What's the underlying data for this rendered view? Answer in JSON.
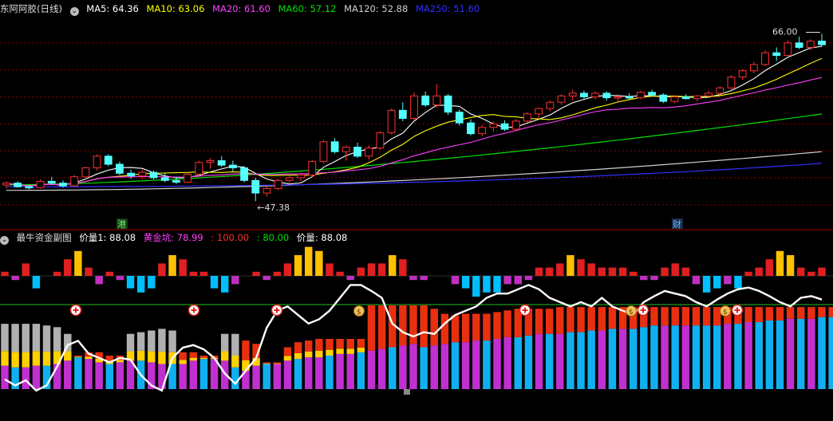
{
  "top_header": {
    "stock_name": "东阿阿胶(日线)",
    "ma5_label": "MA5: 64.36",
    "ma10_label": "MA10: 63.06",
    "ma20_label": "MA20: 61.60",
    "ma60_label": "MA60: 57.12",
    "ma120_label": "MA120: 52.88",
    "ma250_label": "MA250: 51.60"
  },
  "bottom_header": {
    "indicator_name": "最牛资金副图",
    "price1_label": "价量1: 88.08",
    "gold_pit_label": "黄金坑: 78.99",
    "v100_label": ": 100.00",
    "v80_label": ": 80.00",
    "price_label": "价量: 88.08"
  },
  "annotations": {
    "high_price": "66.00",
    "low_price": "47.38",
    "marker_gang": "港",
    "marker_cai": "财"
  },
  "colors": {
    "background": "#000000",
    "up_candle": "#ff3030",
    "down_candle": "#54ffff",
    "ma5": "#ffffff",
    "ma10": "#ffff00",
    "ma20": "#ff40ff",
    "ma60": "#00e000",
    "ma120": "#d0d0d0",
    "ma250": "#3030ff",
    "grid": "#800000",
    "hist_up": "#e02020",
    "hist_up_hi": "#ffc000",
    "hist_down": "#00bfff",
    "hist_down_hi": "#c030c0",
    "bar_red": "#e83010",
    "bar_yellow": "#ffd000",
    "bar_blue": "#10b0f0",
    "bar_magenta": "#c030d0",
    "bar_gray": "#b0b0b0",
    "line80": "#20c020"
  },
  "chart_data": [
    {
      "type": "candlestick",
      "title": "东阿阿胶(日线)",
      "series": [
        {
          "name": "MA5"
        },
        {
          "name": "MA10"
        },
        {
          "name": "MA20"
        },
        {
          "name": "MA60"
        },
        {
          "name": "MA120"
        },
        {
          "name": "MA250"
        }
      ],
      "ylim": [
        46,
        68
      ],
      "candles": [
        [
          49.2,
          49.6,
          48.8,
          49.4
        ],
        [
          49.4,
          49.6,
          48.9,
          49.0
        ],
        [
          49.0,
          49.2,
          48.7,
          48.9
        ],
        [
          48.9,
          49.8,
          48.8,
          49.6
        ],
        [
          49.6,
          50.1,
          49.2,
          49.4
        ],
        [
          49.4,
          49.7,
          48.9,
          49.1
        ],
        [
          49.1,
          50.3,
          49.0,
          50.1
        ],
        [
          50.1,
          51.2,
          50.0,
          51.1
        ],
        [
          51.1,
          52.6,
          50.8,
          52.4
        ],
        [
          52.4,
          52.6,
          51.3,
          51.5
        ],
        [
          51.5,
          51.8,
          50.3,
          50.5
        ],
        [
          50.5,
          50.9,
          49.9,
          50.2
        ],
        [
          50.2,
          50.9,
          49.8,
          50.6
        ],
        [
          50.6,
          50.8,
          49.8,
          50.0
        ],
        [
          50.0,
          50.5,
          49.5,
          49.7
        ],
        [
          49.7,
          50.1,
          49.3,
          49.5
        ],
        [
          49.5,
          50.6,
          49.4,
          50.4
        ],
        [
          50.4,
          51.9,
          50.1,
          51.7
        ],
        [
          51.7,
          52.2,
          51.0,
          51.9
        ],
        [
          51.9,
          52.4,
          51.2,
          51.4
        ],
        [
          51.4,
          51.9,
          50.7,
          51.1
        ],
        [
          51.1,
          51.3,
          49.5,
          49.7
        ],
        [
          49.7,
          50.0,
          47.4,
          48.3
        ],
        [
          48.3,
          49.0,
          47.9,
          48.8
        ],
        [
          48.8,
          49.9,
          48.6,
          49.7
        ],
        [
          49.7,
          50.2,
          49.3,
          50.0
        ],
        [
          50.0,
          50.6,
          49.6,
          50.3
        ],
        [
          50.3,
          52.0,
          50.1,
          51.8
        ],
        [
          51.8,
          54.2,
          51.6,
          54.0
        ],
        [
          54.0,
          54.4,
          52.7,
          52.9
        ],
        [
          52.9,
          53.6,
          51.9,
          53.4
        ],
        [
          53.4,
          53.9,
          52.2,
          52.4
        ],
        [
          52.4,
          53.6,
          52.0,
          53.3
        ],
        [
          53.3,
          55.2,
          53.1,
          55.0
        ],
        [
          55.0,
          57.7,
          54.8,
          57.5
        ],
        [
          57.5,
          58.4,
          56.3,
          56.6
        ],
        [
          56.6,
          59.5,
          56.4,
          59.1
        ],
        [
          59.1,
          59.6,
          57.9,
          58.1
        ],
        [
          58.1,
          60.4,
          57.8,
          59.1
        ],
        [
          59.1,
          59.3,
          57.0,
          57.3
        ],
        [
          57.3,
          57.6,
          55.8,
          56.1
        ],
        [
          56.1,
          56.5,
          54.7,
          54.9
        ],
        [
          54.9,
          55.9,
          54.6,
          55.6
        ],
        [
          55.6,
          56.3,
          55.1,
          56.0
        ],
        [
          56.0,
          56.4,
          55.2,
          55.4
        ],
        [
          55.4,
          56.5,
          55.2,
          56.3
        ],
        [
          56.3,
          57.3,
          56.1,
          57.1
        ],
        [
          57.1,
          57.8,
          56.6,
          57.7
        ],
        [
          57.7,
          58.6,
          57.4,
          58.4
        ],
        [
          58.4,
          59.3,
          58.1,
          59.1
        ],
        [
          59.1,
          59.8,
          58.6,
          59.4
        ],
        [
          59.4,
          59.7,
          58.8,
          59.0
        ],
        [
          59.0,
          59.6,
          58.7,
          59.4
        ],
        [
          59.4,
          59.6,
          58.6,
          58.9
        ],
        [
          58.9,
          59.3,
          58.4,
          59.0
        ],
        [
          59.0,
          59.4,
          58.7,
          58.9
        ],
        [
          58.9,
          59.7,
          58.7,
          59.5
        ],
        [
          59.5,
          59.8,
          59.0,
          59.2
        ],
        [
          59.2,
          59.4,
          58.3,
          58.5
        ],
        [
          58.5,
          59.2,
          58.3,
          59.0
        ],
        [
          59.0,
          59.3,
          58.7,
          58.8
        ],
        [
          58.8,
          59.2,
          58.5,
          59.1
        ],
        [
          59.1,
          59.7,
          58.9,
          59.4
        ],
        [
          59.4,
          60.2,
          59.2,
          60.0
        ],
        [
          60.0,
          61.4,
          59.8,
          61.2
        ],
        [
          61.2,
          62.1,
          60.9,
          61.9
        ],
        [
          61.9,
          62.9,
          61.6,
          62.6
        ],
        [
          62.6,
          64.2,
          62.4,
          63.9
        ],
        [
          63.9,
          64.5,
          63.0,
          63.6
        ],
        [
          63.6,
          65.3,
          63.4,
          65.0
        ],
        [
          65.0,
          65.7,
          64.3,
          64.5
        ],
        [
          64.5,
          65.4,
          64.2,
          65.2
        ],
        [
          65.2,
          66.0,
          64.6,
          64.8
        ]
      ]
    },
    {
      "type": "bar",
      "title": "最牛资金副图",
      "series": [
        {
          "name": "价量1"
        },
        {
          "name": "黄金坑"
        },
        {
          "name": "价量"
        }
      ],
      "hist": [
        1,
        -1,
        3,
        -3,
        0,
        1,
        4,
        6,
        2,
        -2,
        1,
        -1,
        -3,
        -4,
        -3,
        3,
        5,
        4,
        1,
        1,
        -3,
        -4,
        -2,
        0,
        1,
        -1,
        1,
        3,
        5,
        7,
        6,
        3,
        1,
        -1,
        2,
        3,
        3,
        5,
        4,
        -1,
        -1,
        0,
        0,
        -2,
        -3,
        -5,
        -4,
        -4,
        -2,
        -2,
        -1,
        2,
        2,
        3,
        5,
        4,
        3,
        2,
        2,
        2,
        1,
        -1,
        -1,
        2,
        3,
        2,
        -2,
        -4,
        -3,
        -2,
        -3,
        1,
        2,
        4,
        6,
        5,
        2,
        1,
        2
      ],
      "stack_bottom": [
        28,
        26,
        26,
        28,
        28,
        30,
        34,
        38,
        36,
        32,
        30,
        32,
        34,
        34,
        32,
        30,
        30,
        30,
        34,
        36,
        36,
        34,
        26,
        22,
        28,
        30,
        30,
        34,
        36,
        38,
        38,
        40,
        42,
        42,
        44,
        46,
        48,
        50,
        52,
        54,
        50,
        52,
        54,
        56,
        56,
        58,
        58,
        60,
        62,
        62,
        64,
        66,
        66,
        66,
        68,
        68,
        70,
        70,
        72,
        72,
        72,
        74,
        76,
        76,
        76,
        76,
        76,
        76,
        76,
        78,
        78,
        80,
        80,
        82,
        82,
        84,
        84,
        84,
        86,
        86
      ],
      "stack_top": [
        78,
        78,
        78,
        78,
        76,
        74,
        66,
        40,
        44,
        44,
        40,
        40,
        66,
        68,
        70,
        72,
        70,
        44,
        44,
        40,
        40,
        66,
        66,
        58,
        54,
        32,
        32,
        50,
        56,
        58,
        60,
        60,
        60,
        60,
        60,
        100,
        100,
        100,
        100,
        100,
        100,
        96,
        90,
        88,
        90,
        90,
        90,
        92,
        94,
        96,
        96,
        96,
        96,
        98,
        98,
        98,
        98,
        98,
        98,
        98,
        98,
        98,
        98,
        98,
        98,
        98,
        98,
        98,
        98,
        98,
        98,
        98,
        98,
        98,
        98,
        98,
        98,
        98,
        98,
        98
      ],
      "price_line": [
        15,
        8,
        14,
        2,
        8,
        30,
        55,
        60,
        45,
        40,
        35,
        40,
        38,
        20,
        8,
        2,
        40,
        52,
        55,
        50,
        40,
        22,
        10,
        25,
        40,
        75,
        95,
        100,
        90,
        80,
        85,
        95,
        110,
        125,
        125,
        118,
        110,
        80,
        70,
        65,
        70,
        68,
        80,
        90,
        95,
        100,
        110,
        115,
        115,
        120,
        125,
        120,
        110,
        105,
        100,
        105,
        100,
        110,
        100,
        95,
        90,
        105,
        112,
        118,
        115,
        112,
        105,
        100,
        108,
        115,
        120,
        122,
        118,
        112,
        105,
        100,
        110,
        112,
        108
      ],
      "ylim": [
        0,
        130
      ],
      "line80_value": 80
    }
  ]
}
